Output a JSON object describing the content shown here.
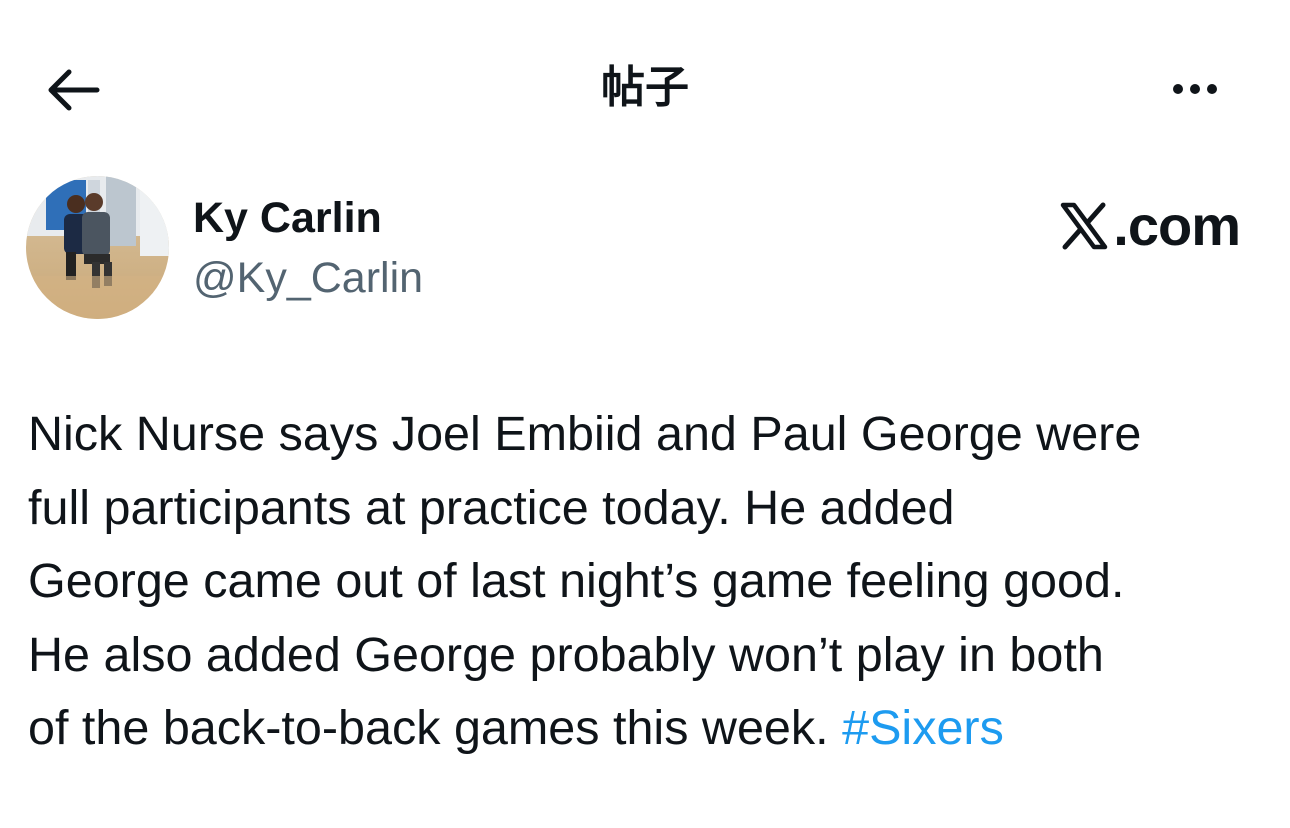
{
  "header": {
    "title": "帖子",
    "back_icon": "arrow-left-icon",
    "more_icon": "more-horizontal-icon"
  },
  "author": {
    "name": "Ky Carlin",
    "handle": "@Ky_Carlin"
  },
  "source": {
    "label": ".com",
    "logo_icon": "x-logo-icon"
  },
  "tweet": {
    "lines": [
      "Nick Nurse says Joel Embiid and Paul George were",
      "full participants at practice today. He added",
      "George came out of last night’s game feeling good.",
      "He also added George probably won’t play in both",
      "of the back-to-back games this week. "
    ],
    "hashtag": "#Sixers"
  },
  "colors": {
    "text": "#0f1419",
    "secondary": "#536471",
    "link": "#1d9bf0",
    "background": "#ffffff"
  }
}
